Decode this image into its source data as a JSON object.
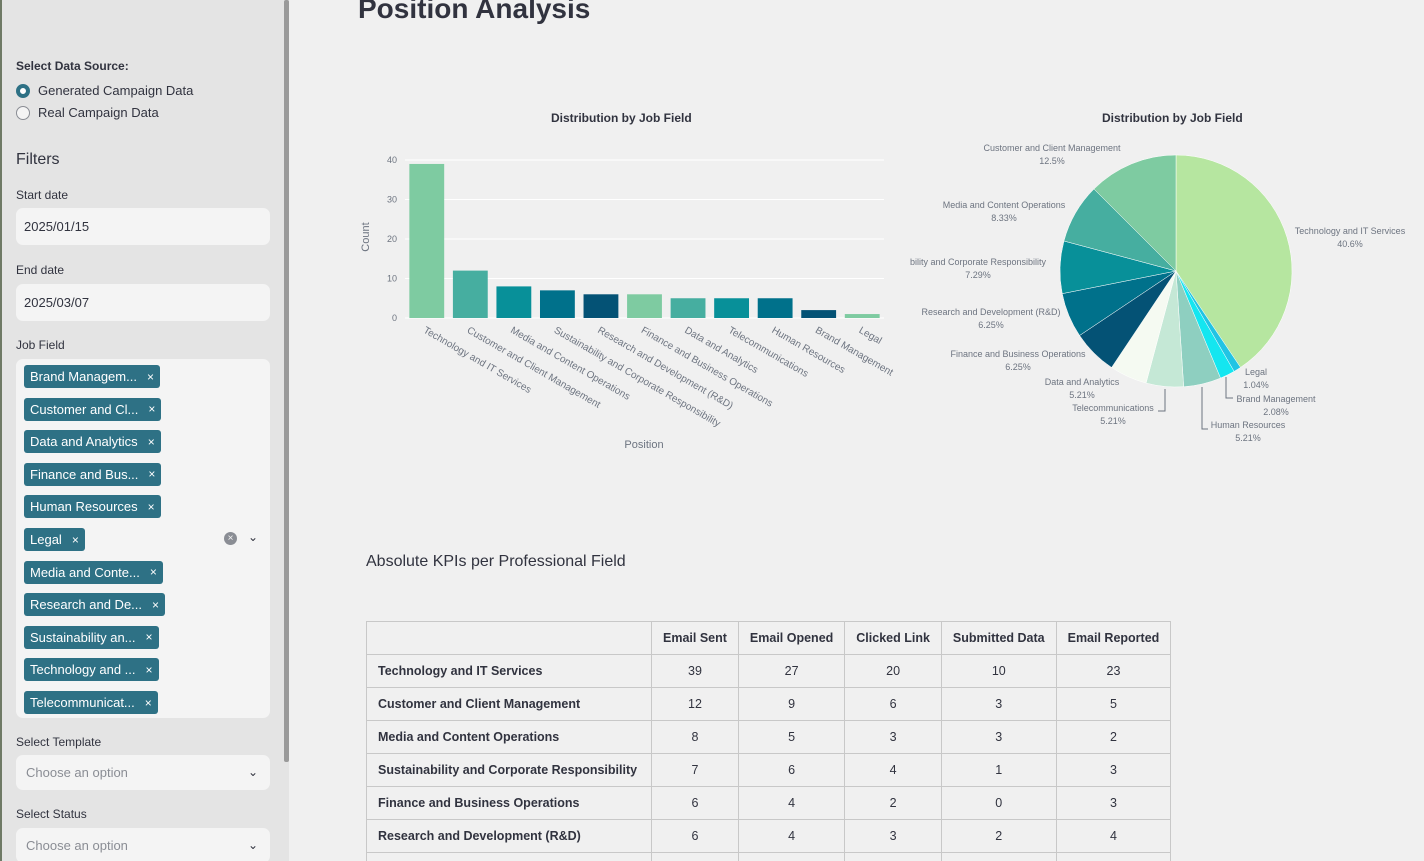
{
  "colors": {
    "accent": "#2e7185",
    "sidebar_bg": "#e4e4e4",
    "input_bg": "#f4f4f4"
  },
  "sidebar": {
    "data_source_label": "Select Data Source:",
    "data_sources": [
      {
        "label": "Generated Campaign Data",
        "selected": true
      },
      {
        "label": "Real Campaign Data",
        "selected": false
      }
    ],
    "filters_heading": "Filters",
    "start_date_label": "Start date",
    "start_date_value": "2025/01/15",
    "end_date_label": "End date",
    "end_date_value": "2025/03/07",
    "job_field_label": "Job Field",
    "job_field_tags": [
      "Brand Managem...",
      "Customer and Cl...",
      "Data and Analytics",
      "Finance and Bus...",
      "Human Resources",
      "Legal",
      "Media and Conte...",
      "Research and De...",
      "Sustainability an...",
      "Technology and ...",
      "Telecommunicat..."
    ],
    "tag_remove_icon": "×",
    "clear_all_icon": "×",
    "chevron_icon": "⌄",
    "template_label": "Select Template",
    "template_placeholder": "Choose an option",
    "status_label": "Select Status",
    "status_placeholder": "Choose an option"
  },
  "main": {
    "title": "Position Analysis",
    "bar_chart_title": "Distribution by Job Field",
    "pie_chart_title": "Distribution by Job Field",
    "kpi_heading": "Absolute KPIs per Professional Field",
    "kpi_table": {
      "columns": [
        "",
        "Email Sent",
        "Email Opened",
        "Clicked Link",
        "Submitted Data",
        "Email Reported"
      ],
      "rows": [
        [
          "Technology and IT Services",
          "39",
          "27",
          "20",
          "10",
          "23"
        ],
        [
          "Customer and Client Management",
          "12",
          "9",
          "6",
          "3",
          "5"
        ],
        [
          "Media and Content Operations",
          "8",
          "5",
          "3",
          "3",
          "2"
        ],
        [
          "Sustainability and Corporate Responsibility",
          "7",
          "6",
          "4",
          "1",
          "3"
        ],
        [
          "Finance and Business Operations",
          "6",
          "4",
          "2",
          "0",
          "3"
        ],
        [
          "Research and Development (R&D)",
          "6",
          "4",
          "3",
          "2",
          "4"
        ]
      ]
    }
  },
  "chart_data": [
    {
      "type": "bar",
      "title": "Distribution by Job Field",
      "xlabel": "Position",
      "ylabel": "Count",
      "ylim": [
        0,
        40
      ],
      "yticks": [
        0,
        10,
        20,
        30,
        40
      ],
      "grid": true,
      "categories": [
        "Technology and IT Services",
        "Customer and Client Management",
        "Media and Content Operations",
        "Sustainability and Corporate Responsibility",
        "Research and Development (R&D)",
        "Finance and Business Operations",
        "Data and Analytics",
        "Telecommunications",
        "Human Resources",
        "Brand Management",
        "Legal"
      ],
      "values": [
        39,
        12,
        8,
        7,
        6,
        6,
        5,
        5,
        5,
        2,
        1
      ],
      "colors": [
        "#7ecba1",
        "#46aea0",
        "#089099",
        "#00718b",
        "#045275",
        "#7ecba1",
        "#46aea0",
        "#089099",
        "#00718b",
        "#045275",
        "#7ecba1"
      ]
    },
    {
      "type": "pie",
      "title": "Distribution by Job Field",
      "slices": [
        {
          "label": "Technology and IT Services",
          "value": 40.6,
          "pct": "40.6%",
          "color": "#b6e6a0"
        },
        {
          "label": "Legal",
          "value": 1.04,
          "pct": "1.04%",
          "color": "#22c4e4"
        },
        {
          "label": "Brand Management",
          "value": 2.08,
          "pct": "2.08%",
          "color": "#14e6f0"
        },
        {
          "label": "Human Resources",
          "value": 5.21,
          "pct": "5.21%",
          "color": "#8ecfc0"
        },
        {
          "label": "Telecommunications",
          "value": 5.21,
          "pct": "5.21%",
          "color": "#c5e8d6"
        },
        {
          "label": "Data and Analytics",
          "value": 5.21,
          "pct": "5.21%",
          "color": "#f5faf2"
        },
        {
          "label": "Finance and Business Operations",
          "value": 6.25,
          "pct": "6.25%",
          "color": "#045275"
        },
        {
          "label": "Research and Development (R&D)",
          "value": 6.25,
          "pct": "6.25%",
          "color": "#00718b"
        },
        {
          "label": "bility and Corporate Responsibility",
          "value": 7.29,
          "pct": "7.29%",
          "color": "#089099"
        },
        {
          "label": "Media and Content Operations",
          "value": 8.33,
          "pct": "8.33%",
          "color": "#46aea0"
        },
        {
          "label": "Customer and Client Management",
          "value": 12.5,
          "pct": "12.5%",
          "color": "#7ecba1"
        }
      ]
    }
  ]
}
